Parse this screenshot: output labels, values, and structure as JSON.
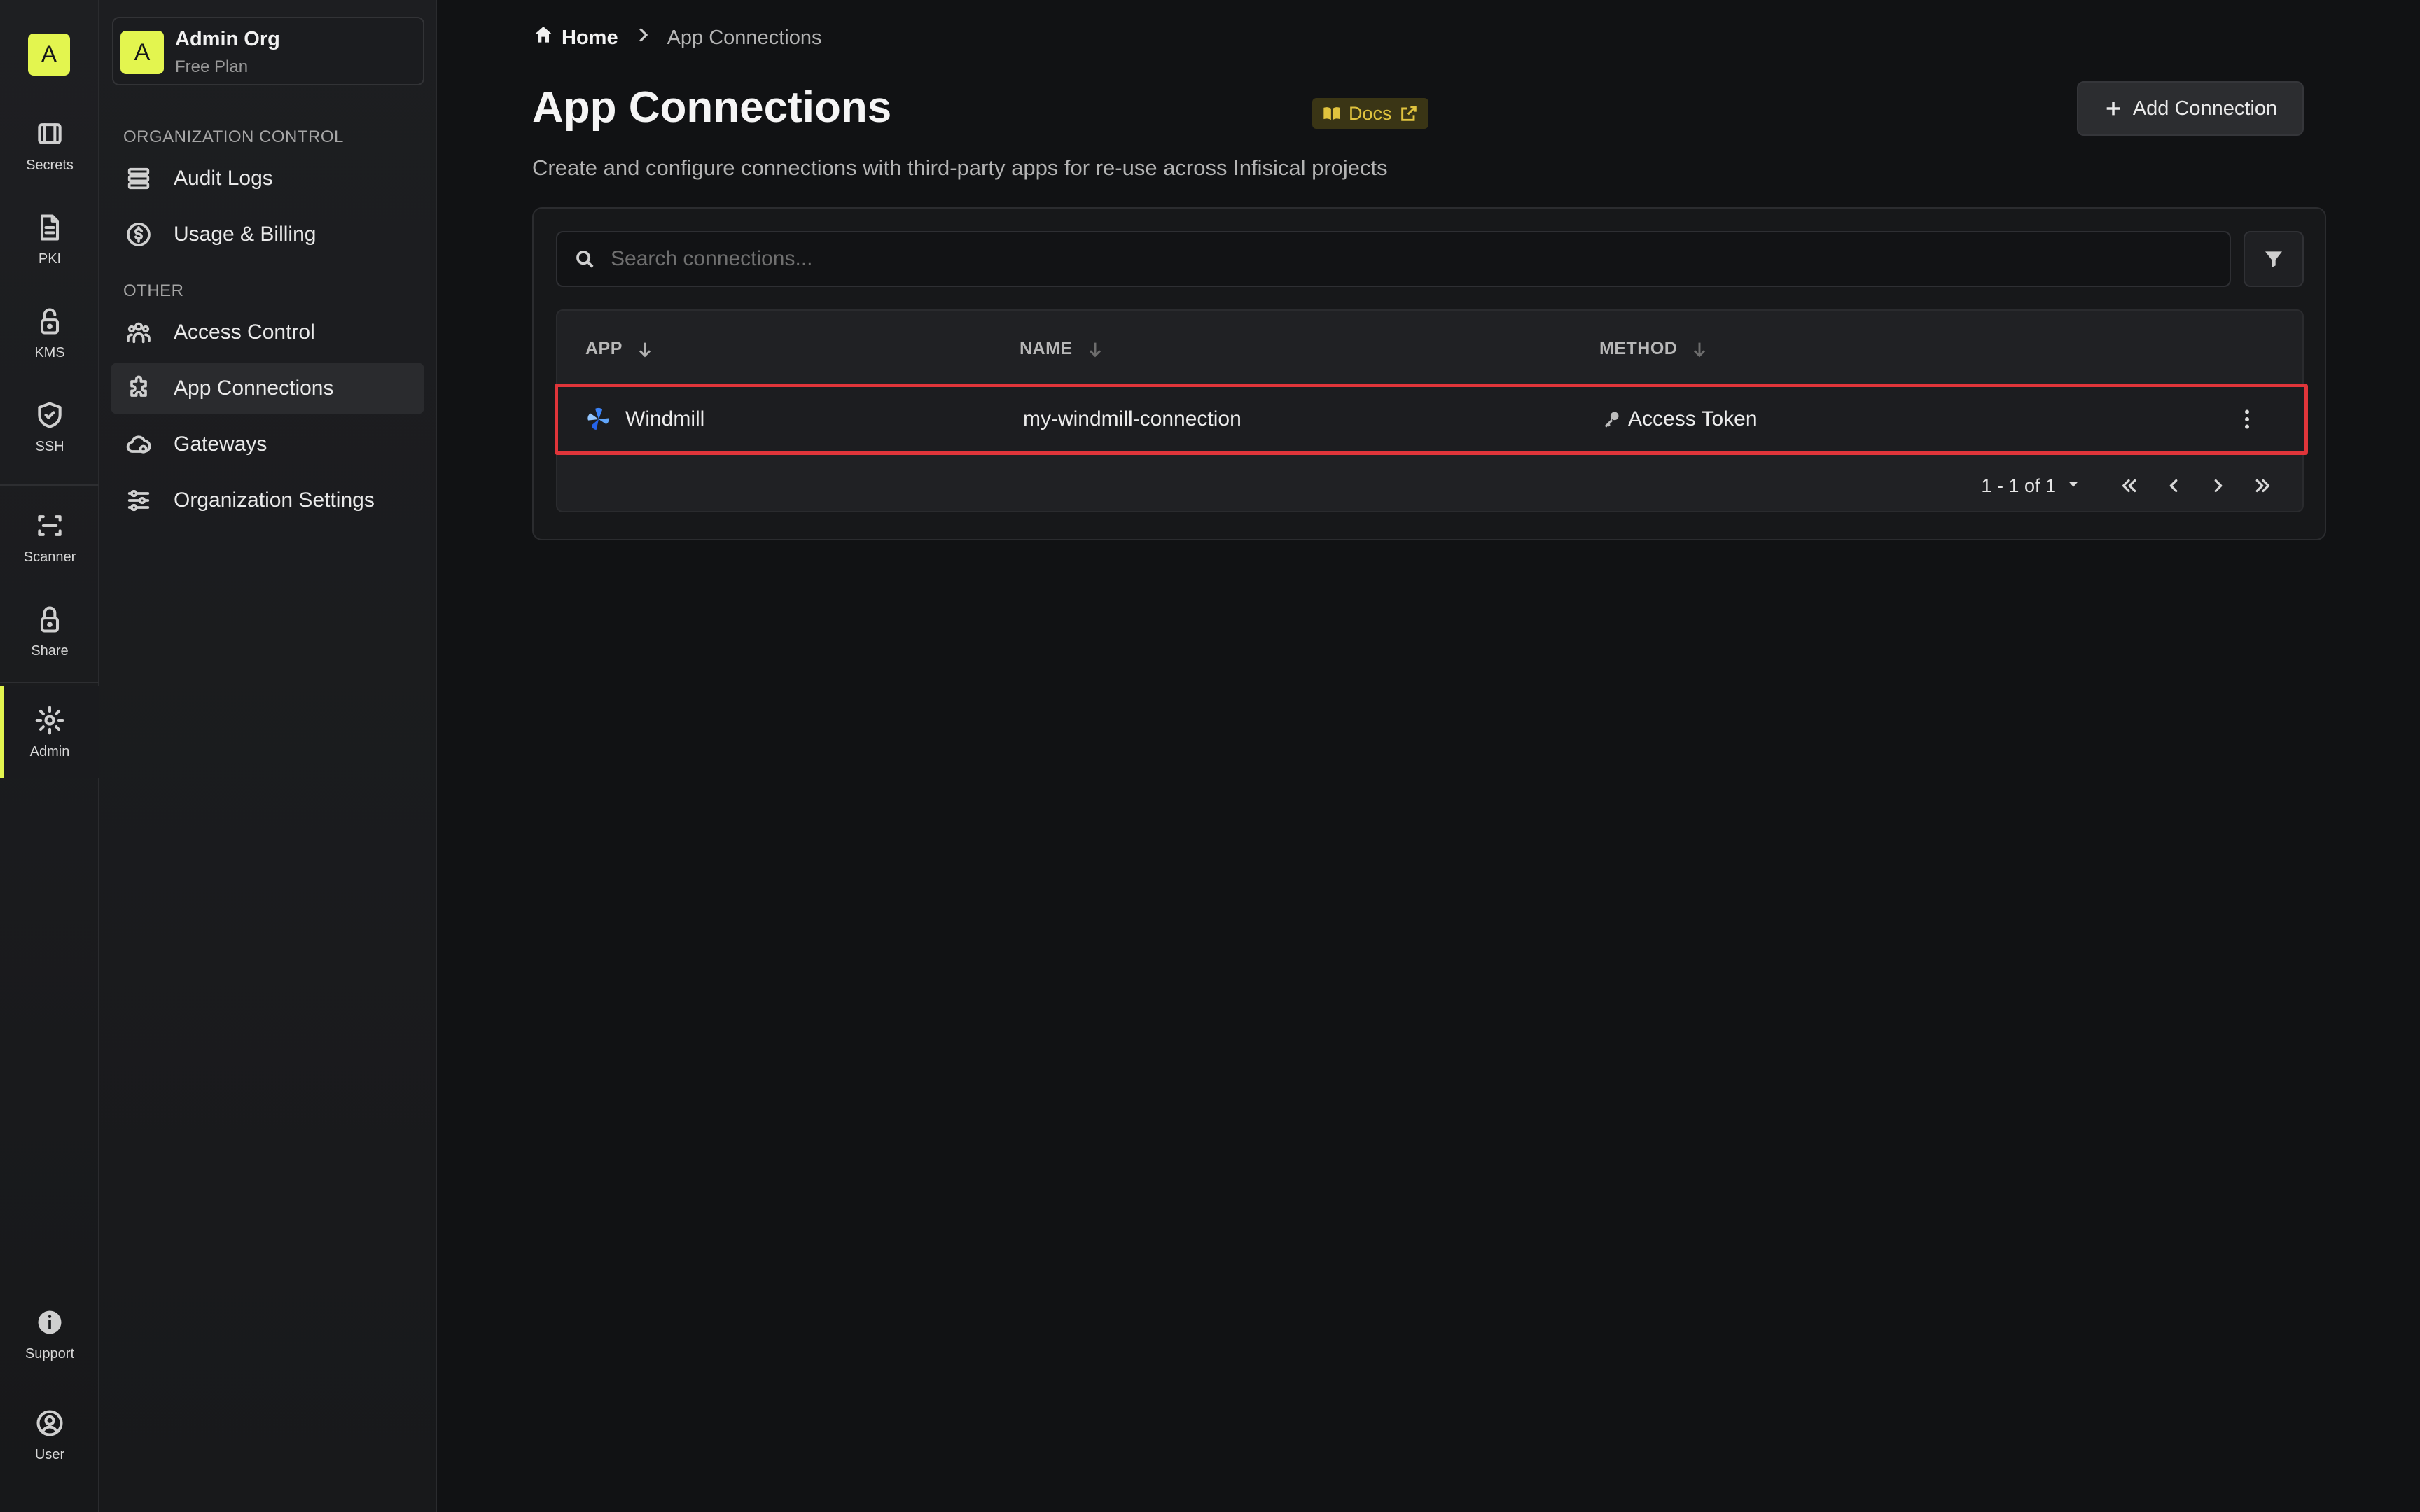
{
  "rail": {
    "logo_letter": "A",
    "items": [
      {
        "label": "Secrets",
        "icon": "vault-icon"
      },
      {
        "label": "PKI",
        "icon": "document-icon"
      },
      {
        "label": "KMS",
        "icon": "lock-open-icon"
      },
      {
        "label": "SSH",
        "icon": "shield-check-icon"
      },
      {
        "label": "Scanner",
        "icon": "scan-icon"
      },
      {
        "label": "Share",
        "icon": "lock-icon"
      },
      {
        "label": "Admin",
        "icon": "gear-icon"
      },
      {
        "label": "Support",
        "icon": "info-icon"
      },
      {
        "label": "User",
        "icon": "user-icon"
      }
    ],
    "accent_color": "#e3f54f"
  },
  "org": {
    "avatar_letter": "A",
    "name": "Admin Org",
    "plan": "Free Plan"
  },
  "sidebar": {
    "section1": "ORGANIZATION CONTROL",
    "section2": "OTHER",
    "items": [
      {
        "label": "Audit Logs",
        "icon": "list-icon"
      },
      {
        "label": "Usage & Billing",
        "icon": "dollar-icon"
      },
      {
        "label": "Access Control",
        "icon": "users-icon"
      },
      {
        "label": "App Connections",
        "icon": "puzzle-icon",
        "active": true
      },
      {
        "label": "Gateways",
        "icon": "cloud-icon"
      },
      {
        "label": "Organization Settings",
        "icon": "sliders-icon"
      }
    ]
  },
  "breadcrumb": {
    "home": "Home",
    "current": "App Connections"
  },
  "page": {
    "title": "App Connections",
    "docs_label": "Docs",
    "subtitle": "Create and configure connections with third-party apps for re-use across Infisical projects",
    "add_button": "Add Connection"
  },
  "search": {
    "placeholder": "Search connections..."
  },
  "table": {
    "headers": {
      "app": "APP",
      "name": "NAME",
      "method": "METHOD"
    },
    "rows": [
      {
        "app": "Windmill",
        "name": "my-windmill-connection",
        "method": "Access Token"
      }
    ],
    "highlight_color": "#e0353a"
  },
  "pagination": {
    "summary": "1 - 1 of 1"
  }
}
